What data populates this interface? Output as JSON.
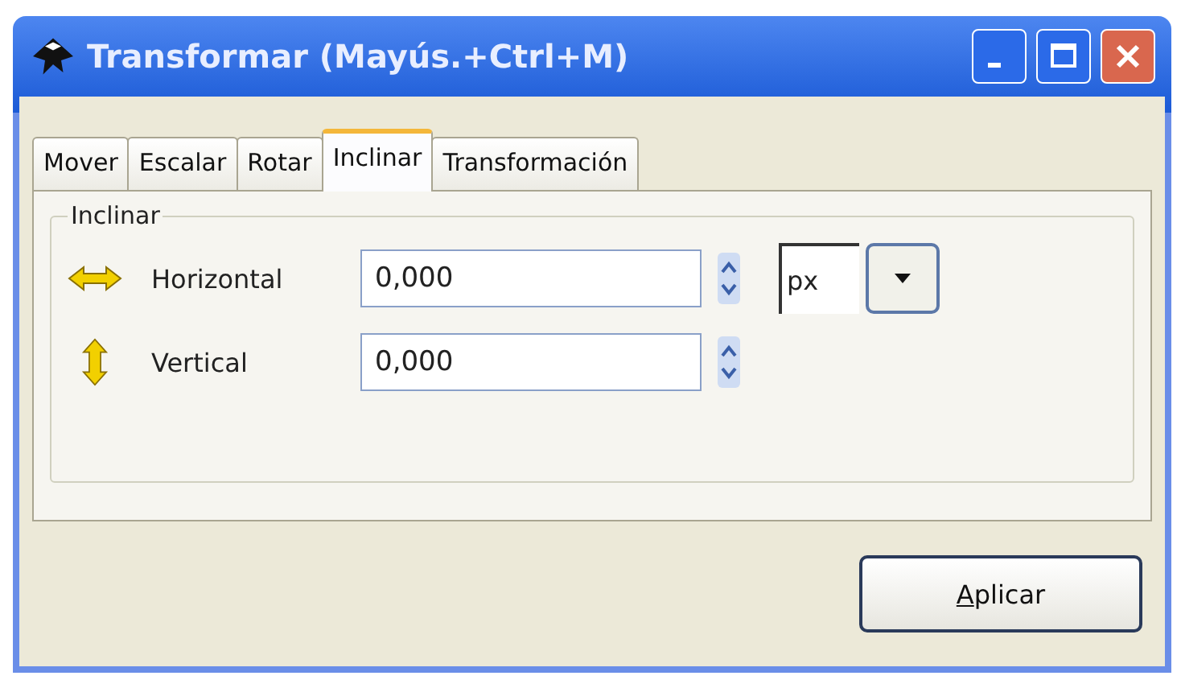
{
  "window": {
    "title": "Transformar (Mayús.+Ctrl+M)"
  },
  "tabs": [
    {
      "label": "Mover",
      "selected": false
    },
    {
      "label": "Escalar",
      "selected": false
    },
    {
      "label": "Rotar",
      "selected": false
    },
    {
      "label": "Inclinar",
      "selected": true
    },
    {
      "label": "Transformación",
      "selected": false
    }
  ],
  "group": {
    "title": "Inclinar",
    "rows": [
      {
        "kind": "horizontal",
        "label": "Horizontal",
        "value": "0,000",
        "unit": "px"
      },
      {
        "kind": "vertical",
        "label": "Vertical",
        "value": "0,000"
      }
    ]
  },
  "buttons": [
    "Aplicar"
  ]
}
